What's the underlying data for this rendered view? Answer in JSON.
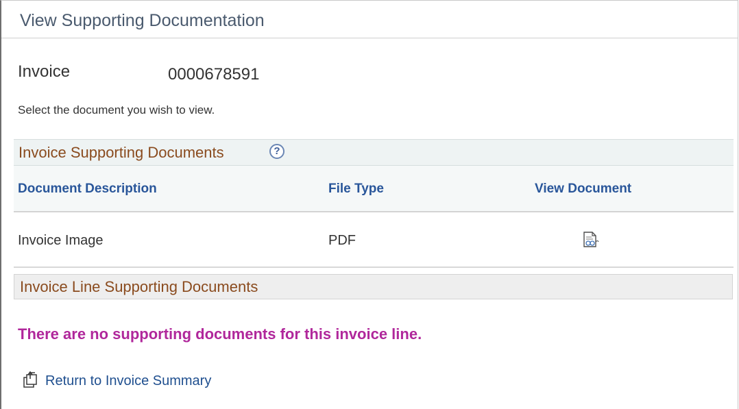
{
  "page": {
    "title": "View Supporting Documentation"
  },
  "invoice": {
    "label": "Invoice",
    "value": "0000678591"
  },
  "instructions": "Select the document you wish to view.",
  "invoice_docs": {
    "caption": "Invoice Supporting Documents",
    "help_icon": "help-icon",
    "help_glyph": "?",
    "columns": [
      "Document Description",
      "File Type",
      "View Document"
    ],
    "rows": [
      {
        "description": "Invoice Image",
        "file_type": "PDF",
        "view_icon": "view-document-icon"
      }
    ]
  },
  "line_docs": {
    "caption": "Invoice Line Supporting Documents",
    "empty_message": "There are no supporting documents for this invoice line."
  },
  "return_link": {
    "label": "Return to Invoice Summary",
    "icon": "return-icon"
  },
  "colors": {
    "title": "#4a5a6e",
    "caption": "#8a4b1e",
    "column_header": "#29569a",
    "empty_message": "#b0279b",
    "link": "#1f4f8f"
  }
}
